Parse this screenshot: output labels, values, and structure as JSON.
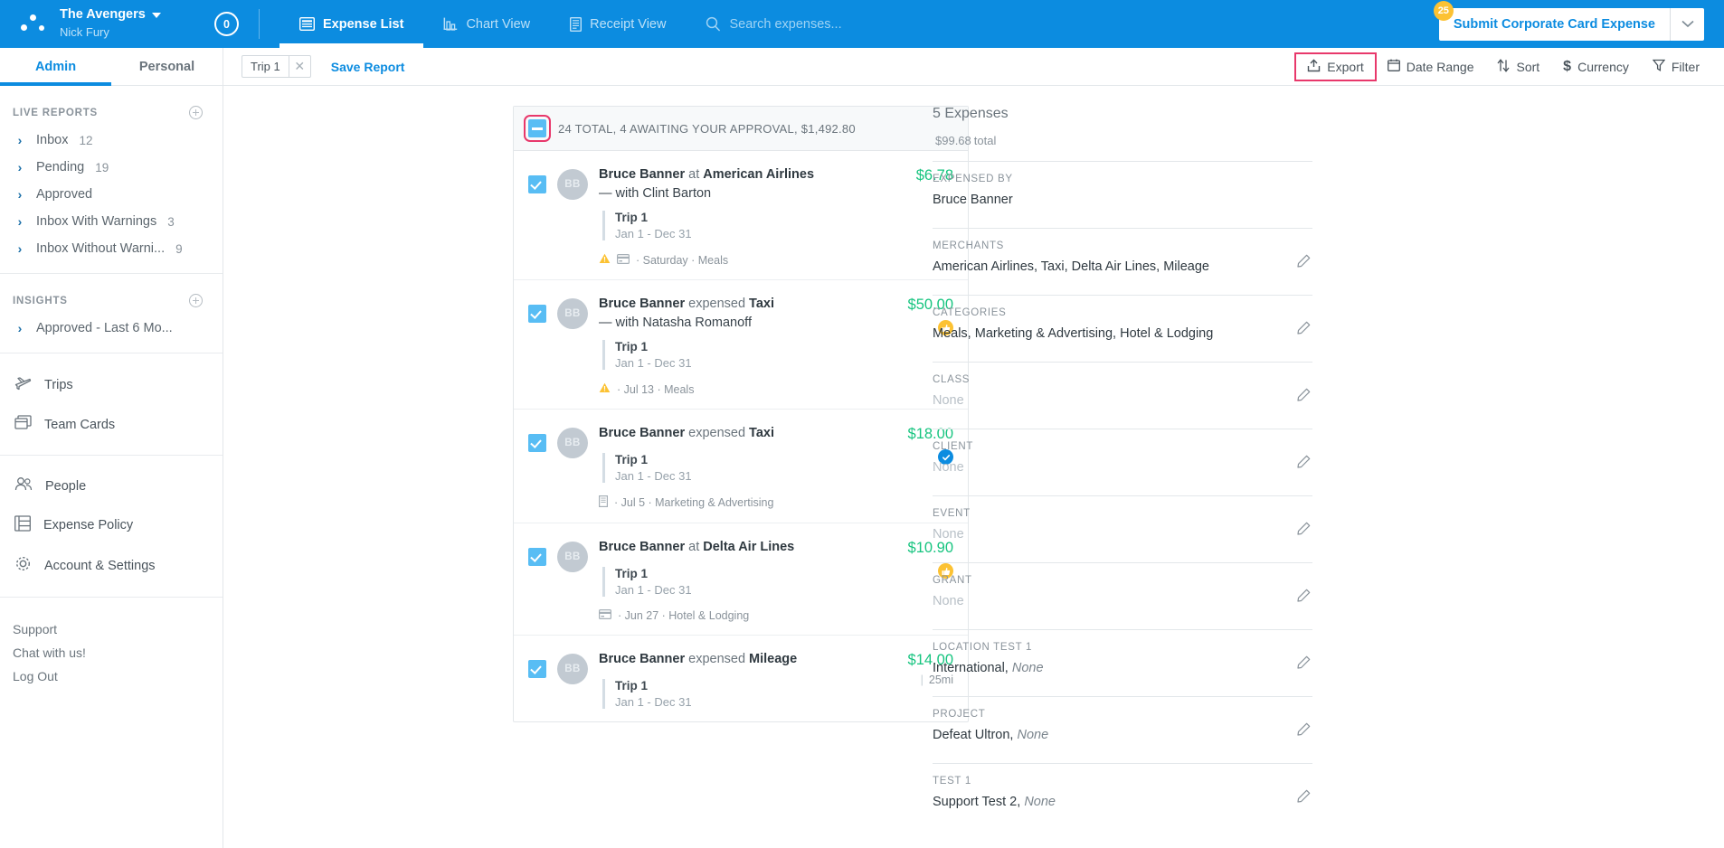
{
  "topbar": {
    "org": "The Avengers",
    "user": "Nick Fury",
    "count_badge": "0",
    "tabs": [
      {
        "label": "Expense List",
        "icon": "list-icon",
        "active": true
      },
      {
        "label": "Chart View",
        "icon": "chart-icon",
        "active": false
      },
      {
        "label": "Receipt View",
        "icon": "receipt-icon",
        "active": false
      }
    ],
    "search_placeholder": "Search expenses...",
    "submit_label": "Submit Corporate Card Expense",
    "submit_badge": "25"
  },
  "subbar": {
    "account_tabs": [
      {
        "label": "Admin",
        "active": true
      },
      {
        "label": "Personal",
        "active": false
      }
    ],
    "filter_chip": "Trip 1",
    "save_report": "Save Report",
    "tools": [
      {
        "label": "Export",
        "icon": "export-icon",
        "highlight": true
      },
      {
        "label": "Date Range",
        "icon": "calendar-icon",
        "highlight": false
      },
      {
        "label": "Sort",
        "icon": "sort-icon",
        "highlight": false
      },
      {
        "label": "Currency",
        "icon": "dollar-icon",
        "highlight": false
      },
      {
        "label": "Filter",
        "icon": "funnel-icon",
        "highlight": false
      }
    ]
  },
  "sidebar": {
    "live_reports_title": "LIVE REPORTS",
    "live_reports": [
      {
        "label": "Inbox",
        "count": "12"
      },
      {
        "label": "Pending",
        "count": "19"
      },
      {
        "label": "Approved",
        "count": ""
      },
      {
        "label": "Inbox With Warnings",
        "count": "3"
      },
      {
        "label": "Inbox Without Warni...",
        "count": "9"
      }
    ],
    "insights_title": "INSIGHTS",
    "insights": [
      {
        "label": "Approved - Last 6 Mo...",
        "count": ""
      }
    ],
    "nav": [
      {
        "label": "Trips",
        "icon": "plane-icon"
      },
      {
        "label": "Team Cards",
        "icon": "cards-icon"
      }
    ],
    "nav2": [
      {
        "label": "People",
        "icon": "people-icon"
      },
      {
        "label": "Expense Policy",
        "icon": "policy-icon"
      },
      {
        "label": "Account & Settings",
        "icon": "gear-icon"
      }
    ],
    "footer": [
      {
        "label": "Support"
      },
      {
        "label": "Chat with us!"
      },
      {
        "label": "Log Out"
      }
    ]
  },
  "list": {
    "header": "24 TOTAL, 4 AWAITING YOUR APPROVAL, $1,492.80",
    "rows": [
      {
        "initials": "BB",
        "person": "Bruce Banner",
        "connector": "at",
        "merchant": "American Airlines",
        "with": "— with Clint Barton",
        "trip": "Trip 1",
        "dates": "Jan 1 - Dec 31",
        "meta": "· Saturday · Meals",
        "amount": "$6.78",
        "miles": "",
        "badge": "none",
        "warn": true,
        "card": true
      },
      {
        "initials": "BB",
        "person": "Bruce Banner",
        "connector": "expensed",
        "merchant": "Taxi",
        "with": "— with Natasha Romanoff",
        "trip": "Trip 1",
        "dates": "Jan 1 - Dec 31",
        "meta": "· Jul 13 · Meals",
        "amount": "$50.00",
        "miles": "",
        "badge": "thumb",
        "warn": true,
        "card": false
      },
      {
        "initials": "BB",
        "person": "Bruce Banner",
        "connector": "expensed",
        "merchant": "Taxi",
        "with": "",
        "trip": "Trip 1",
        "dates": "Jan 1 - Dec 31",
        "meta": "· Jul 5 · Marketing & Advertising",
        "amount": "$18.00",
        "miles": "",
        "badge": "check",
        "warn": false,
        "card": false,
        "receipt": true
      },
      {
        "initials": "BB",
        "person": "Bruce Banner",
        "connector": "at",
        "merchant": "Delta Air Lines",
        "with": "",
        "trip": "Trip 1",
        "dates": "Jan 1 - Dec 31",
        "meta": "· Jun 27 · Hotel & Lodging",
        "amount": "$10.90",
        "miles": "",
        "badge": "thumb",
        "warn": false,
        "card": true
      },
      {
        "initials": "BB",
        "person": "Bruce Banner",
        "connector": "expensed",
        "merchant": "Mileage",
        "with": "",
        "trip": "Trip 1",
        "dates": "Jan 1 - Dec 31",
        "meta": "",
        "amount": "$14.00",
        "miles": "25mi",
        "badge": "none",
        "warn": false,
        "card": false
      }
    ]
  },
  "detail": {
    "count": "5 Expenses",
    "total": "$99.68",
    "total_suffix": "total",
    "fields": [
      {
        "label": "EXPENSED BY",
        "value": "Bruce Banner",
        "value2": "",
        "none": false,
        "editable": false
      },
      {
        "label": "MERCHANTS",
        "value": "American Airlines, Taxi, Delta Air Lines, Mileage",
        "value2": "",
        "none": false,
        "editable": true
      },
      {
        "label": "CATEGORIES",
        "value": "Meals, Marketing & Advertising, Hotel & Lodging",
        "value2": "",
        "none": false,
        "editable": true
      },
      {
        "label": "CLASS",
        "value": "None",
        "value2": "",
        "none": true,
        "editable": true
      },
      {
        "label": "CLIENT",
        "value": "None",
        "value2": "",
        "none": true,
        "editable": true
      },
      {
        "label": "EVENT",
        "value": "None",
        "value2": "",
        "none": true,
        "editable": true
      },
      {
        "label": "GRANT",
        "value": "None",
        "value2": "",
        "none": true,
        "editable": true
      },
      {
        "label": "LOCATION TEST 1",
        "value": "International,",
        "value2": "None",
        "none": false,
        "editable": true
      },
      {
        "label": "PROJECT",
        "value": "Defeat Ultron,",
        "value2": "None",
        "none": false,
        "editable": true
      },
      {
        "label": "TEST 1",
        "value": "Support Test 2,",
        "value2": "None",
        "none": false,
        "editable": true
      }
    ]
  },
  "colors": {
    "brand_blue": "#0c8ce0",
    "accent_green": "#16c47f",
    "highlight_pink": "#e8386b",
    "badge_yellow": "#fcc233",
    "checkbox_blue": "#58bdf4"
  }
}
